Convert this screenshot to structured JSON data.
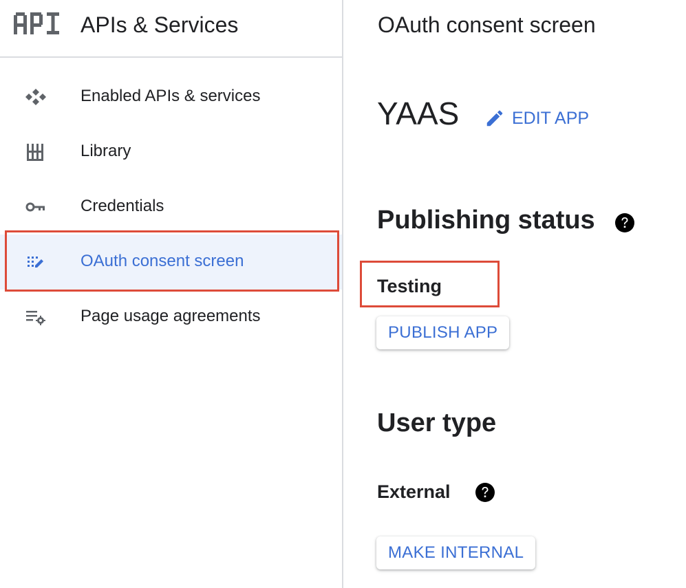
{
  "sidebar": {
    "logo_text": "API",
    "title": "APIs & Services",
    "items": [
      {
        "label": "Enabled APIs & services",
        "icon": "enabled-apis-icon",
        "active": false
      },
      {
        "label": "Library",
        "icon": "library-icon",
        "active": false
      },
      {
        "label": "Credentials",
        "icon": "key-icon",
        "active": false
      },
      {
        "label": "OAuth consent screen",
        "icon": "oauth-consent-icon",
        "active": true
      },
      {
        "label": "Page usage agreements",
        "icon": "page-usage-settings-icon",
        "active": false
      }
    ]
  },
  "main": {
    "page_title": "OAuth consent screen",
    "app_name": "YAAS",
    "edit_app_label": "EDIT APP",
    "publishing_status": {
      "heading": "Publishing status",
      "value": "Testing",
      "button_label": "PUBLISH APP"
    },
    "user_type": {
      "heading": "User type",
      "value": "External",
      "button_label": "MAKE INTERNAL"
    }
  },
  "colors": {
    "accent_blue": "#3b6fd4",
    "active_bg": "#eef3fc",
    "highlight_red": "#dd4b39",
    "divider": "#dadce0",
    "text": "#202124",
    "icon_gray": "#5f6368"
  }
}
